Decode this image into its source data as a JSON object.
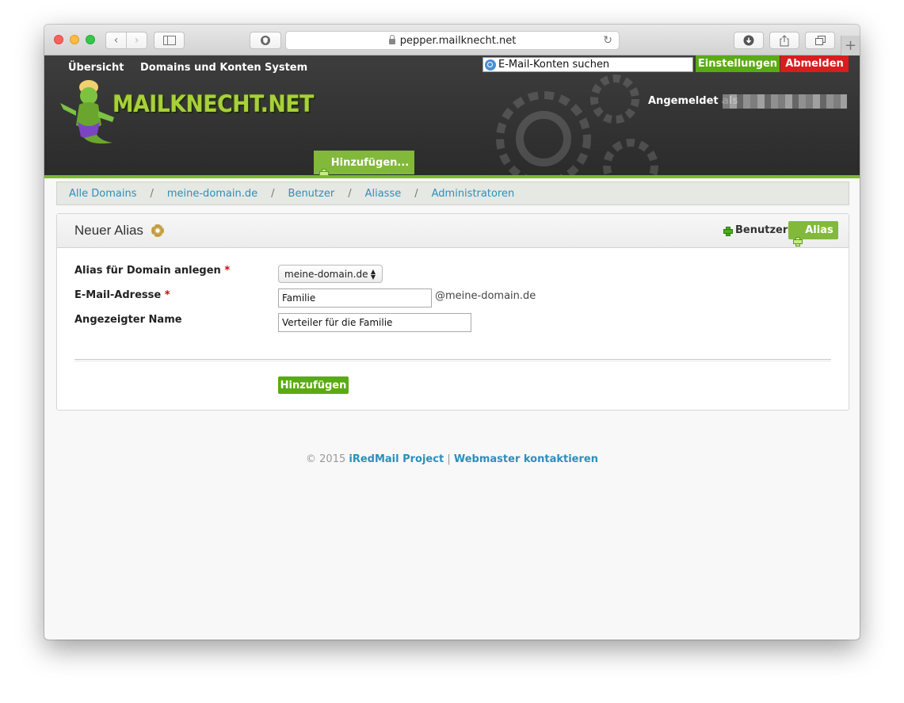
{
  "browser": {
    "url": "pepper.mailknecht.net"
  },
  "header": {
    "search_placeholder": "E-Mail-Konten suchen",
    "settings_label": "Einstellungen",
    "logout_label": "Abmelden",
    "logo_text": "MAILKNECHT.NET",
    "logged_in_label": "Angemeldet als",
    "nav": [
      "Übersicht",
      "Domains und Konten",
      "System"
    ],
    "nav_add_label": "Hinzufügen..."
  },
  "breadcrumb": [
    "Alle Domains",
    "meine-domain.de",
    "Benutzer",
    "Aliasse",
    "Administratoren"
  ],
  "panel": {
    "title": "Neuer Alias",
    "user_link": "Benutzer",
    "alias_link": "Alias"
  },
  "form": {
    "domain_label": "Alias für Domain anlegen",
    "domain_value": "meine-domain.de",
    "email_label": "E-Mail-Adresse",
    "email_value": "Familie",
    "email_suffix": "@meine-domain.de",
    "name_label": "Angezeigter Name",
    "name_value": "Verteiler für die Familie",
    "required_marker": "*",
    "submit_label": "Hinzufügen"
  },
  "footer": {
    "copyright": "© 2015",
    "project_link": "iRedMail Project",
    "separator": "|",
    "contact_link": "Webmaster kontaktieren"
  }
}
